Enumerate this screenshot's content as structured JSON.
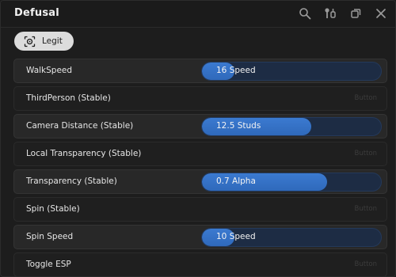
{
  "window": {
    "title": "Defusal"
  },
  "toolbar": {
    "icons": [
      "search-icon",
      "pin-settings-icon",
      "minimize-icon",
      "close-icon"
    ]
  },
  "tab": {
    "label": "Legit",
    "icon": "target-icon"
  },
  "rows": [
    {
      "label": "WalkSpeed",
      "kind": "slider",
      "value_text": "16 Speed",
      "fill": 0.18
    },
    {
      "label": "ThirdPerson (Stable)",
      "kind": "button",
      "hint": "Button"
    },
    {
      "label": "Camera Distance (Stable)",
      "kind": "slider",
      "value_text": "12.5 Studs",
      "fill": 0.61
    },
    {
      "label": "Local Transparency (Stable)",
      "kind": "button",
      "hint": "Button"
    },
    {
      "label": "Transparency (Stable)",
      "kind": "slider",
      "value_text": "0.7 Alpha",
      "fill": 0.7
    },
    {
      "label": "Spin (Stable)",
      "kind": "button",
      "hint": "Button"
    },
    {
      "label": "Spin Speed",
      "kind": "slider",
      "value_text": "10 Speed",
      "fill": 0.18
    },
    {
      "label": "Toggle ESP",
      "kind": "button",
      "hint": "Button"
    }
  ],
  "colors": {
    "accent": "#3b7ad0",
    "track": "#1d2c44",
    "background": "#1d1d1d"
  }
}
